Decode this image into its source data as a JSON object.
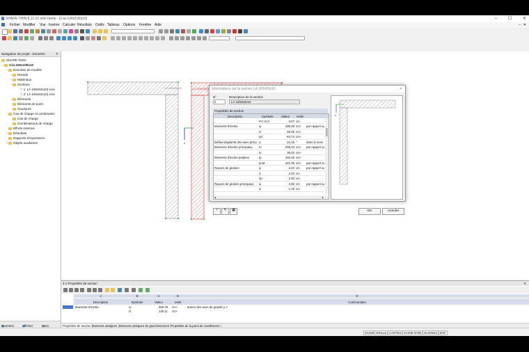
{
  "window": {
    "title": "SHAPE-THIN 8.21.01 x64 Demo - [2-la-100x100x10]"
  },
  "menu": [
    "Fichier",
    "Modifier",
    "Vue",
    "Insérer",
    "Calculer",
    "Résultats",
    "Outils",
    "Tableau",
    "Options",
    "Fenêtre",
    "Aide"
  ],
  "navigator": {
    "title": "Navigateur de projet - Données",
    "tree": [
      {
        "label": "SHAPE-THIN",
        "level": 0
      },
      {
        "label": "2-la-100x100x10",
        "level": 1
      },
      {
        "label": "Données de modèle",
        "level": 2
      },
      {
        "label": "Nœuds",
        "level": 3
      },
      {
        "label": "Matériaux",
        "level": 3
      },
      {
        "label": "Sections",
        "level": 3
      },
      {
        "label": "1: LA 100x63x10| Acie",
        "level": 4
      },
      {
        "label": "2: LA 100x63x10| Acie",
        "level": 4
      },
      {
        "label": "Éléments",
        "level": 3
      },
      {
        "label": "Éléments de point",
        "level": 3
      },
      {
        "label": "Soudures",
        "level": 3
      },
      {
        "label": "Cas de charge et combinaiso",
        "level": 2
      },
      {
        "label": "Cas de charge",
        "level": 3
      },
      {
        "label": "Combinaisons de charge",
        "level": 3
      },
      {
        "label": "Efforts internes",
        "level": 2
      },
      {
        "label": "Résultats",
        "level": 2
      },
      {
        "label": "Rapports d'impression",
        "level": 2
      },
      {
        "label": "Objets auxiliaires",
        "level": 2
      }
    ],
    "tabs": [
      "Données",
      "Afficher",
      "Vues"
    ]
  },
  "drawing": {
    "left_label": "LA 100x63x10",
    "right_label": "LA 100x63x10"
  },
  "dialog": {
    "title": "Informations sur la section LA 100x63x10",
    "no_label": "N°",
    "no_value": "2",
    "desc_label": "Description de la section",
    "desc_value": "LA 100x63x10",
    "props_label": "Propriétés de section",
    "columns": [
      "Description",
      "Symbole",
      "Valeur",
      "Unité",
      ""
    ],
    "rows": [
      {
        "d": "",
        "s": "P.C.G.0",
        "v": "3.07",
        "u": "cm",
        "c": ""
      },
      {
        "d": "Moments d'inertie",
        "s": "Iy",
        "v": "180.39",
        "u": "cm⁴",
        "c": "par rapport au"
      },
      {
        "d": "",
        "s": "Iz",
        "v": "65.05",
        "u": "cm⁴",
        "c": ""
      },
      {
        "d": "",
        "s": "Iyz",
        "v": "-64.74",
        "u": "cm⁴",
        "c": ""
      },
      {
        "d": "Défaut d'aplomb des axes princi",
        "s": "α",
        "v": "24.15",
        "u": "°",
        "c": "dans le sens"
      },
      {
        "d": "Moments d'inertie principaux",
        "s": "Iu",
        "v": "209.43",
        "u": "cm⁴",
        "c": "par rapport au"
      },
      {
        "d": "",
        "s": "Iv",
        "v": "36.02",
        "u": "cm⁴",
        "c": ""
      },
      {
        "d": "Moments d'inertie polaires",
        "s": "Ip",
        "v": "245.45",
        "u": "cm⁴",
        "c": ""
      },
      {
        "d": "",
        "s": "Ip,M",
        "v": "421.35",
        "u": "cm⁴",
        "c": "par rapport au"
      },
      {
        "d": "Rayons de giration",
        "s": "iy",
        "v": "3.20",
        "u": "cm",
        "c": "par rapport au"
      },
      {
        "d": "",
        "s": "iz",
        "v": "2.00",
        "u": "cm",
        "c": ""
      },
      {
        "d": "",
        "s": "iyz",
        "v": "2.00",
        "u": "cm",
        "c": ""
      },
      {
        "d": "Rayons de giration principaux",
        "s": "iu",
        "v": "3.55",
        "u": "cm",
        "c": "par rapport au"
      },
      {
        "d": "",
        "s": "iv",
        "v": "1.49",
        "u": "cm",
        "c": ""
      }
    ],
    "ok": "OK",
    "cancel": "Annuler"
  },
  "bottom": {
    "title": "4.1 Propriétés de section",
    "col_letters": [
      "A",
      "B",
      "C",
      "D",
      "E"
    ],
    "col_heads": [
      "Description",
      "Symbole",
      "Valeur",
      "Unité",
      "Commentaire"
    ],
    "rows": [
      {
        "d": "Moments d'inertie",
        "s": "Iy",
        "v": "360.78",
        "u": "cm⁴",
        "c": "autour des axes de gravité y, z"
      },
      {
        "d": "",
        "s": "Iz",
        "v": "130.11",
        "u": "cm⁴",
        "c": ""
      }
    ],
    "tabs": [
      "Propriétés de section",
      "Moments statiques",
      "Moments statiques de gauchissement",
      "Propriétés de la paroi de cisaillement"
    ]
  },
  "status": [
    "SAISIE",
    "GRILLE",
    "CARTES",
    "SAISIE D'OB",
    "GLIGNES",
    "DXF"
  ]
}
